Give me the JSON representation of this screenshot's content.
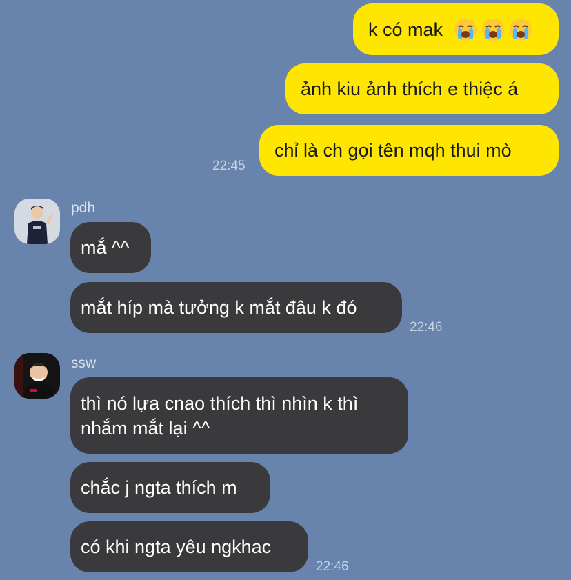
{
  "messages": {
    "outgoing": [
      {
        "text": "k có mak",
        "emojis": [
          "loudly-crying-face",
          "loudly-crying-face",
          "loudly-crying-face"
        ]
      },
      {
        "text": "ảnh kiu ảnh thích e thiệc á"
      },
      {
        "text": "chỉ là ch gọi tên mqh thui mò"
      }
    ],
    "outgoing_time": "22:45"
  },
  "groups": [
    {
      "sender": "pdh",
      "avatar_icon": "player-avatar-pdh",
      "messages": [
        "mắ ^^",
        "mắt híp mà tưởng k mắt đâu k đó"
      ],
      "time": "22:46"
    },
    {
      "sender": "ssw",
      "avatar_icon": "player-avatar-ssw",
      "messages": [
        "thì nó lựa cnao thích thì nhìn k thì",
        "nhắm mắt lại ^^",
        "chắc j ngta thích m",
        "có khi ngta yêu ngkhac"
      ],
      "time": "22:46"
    }
  ],
  "colors": {
    "background": "#6884ad",
    "outgoing_bubble": "#ffe600",
    "incoming_bubble": "#3a3a3c"
  }
}
